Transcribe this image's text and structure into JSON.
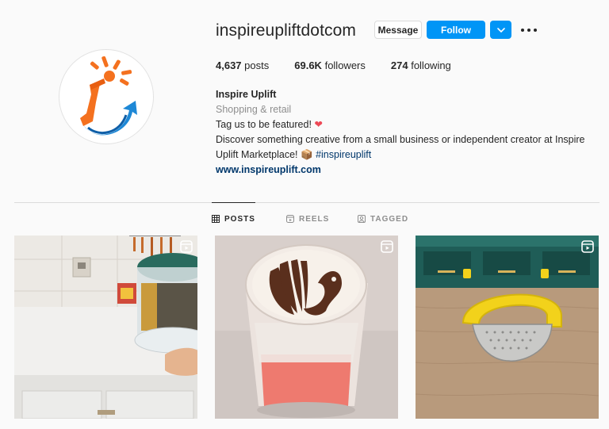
{
  "profile": {
    "username": "inspireupliftdotcom",
    "avatar_icon": "inspire-uplift-logo"
  },
  "actions": {
    "message_label": "Message",
    "follow_label": "Follow",
    "dropdown_icon": "chevron-down-icon",
    "more_icon": "more-options-icon"
  },
  "stats": {
    "posts_count": "4,637",
    "posts_label": "posts",
    "followers_count": "69.6K",
    "followers_label": "followers",
    "following_count": "274",
    "following_label": "following"
  },
  "bio": {
    "name": "Inspire Uplift",
    "category": "Shopping & retail",
    "line1": "Tag us to be featured!",
    "line1_emoji": "❤",
    "line2": "Discover something creative from a small business or independent creator at Inspire Uplift Marketplace!",
    "line2_emoji": "📦",
    "hashtag": "#inspireuplift",
    "website": "www.inspireuplift.com"
  },
  "tabs": [
    {
      "label": "POSTS",
      "icon": "grid-icon",
      "active": true
    },
    {
      "label": "REELS",
      "icon": "reels-icon",
      "active": false
    },
    {
      "label": "TAGGED",
      "icon": "tagged-icon",
      "active": false
    }
  ],
  "posts": [
    {
      "subject": "kitchen rotating storage container",
      "badge_icon": "reel-icon"
    },
    {
      "subject": "latte art flamingo drink",
      "badge_icon": "reel-icon"
    },
    {
      "subject": "yellow handheld grater",
      "badge_icon": "reel-icon"
    }
  ],
  "colors": {
    "follow_blue": "#0095f6",
    "logo_orange": "#f4711f",
    "logo_blue": "#1e88d6",
    "link": "#00376b"
  }
}
